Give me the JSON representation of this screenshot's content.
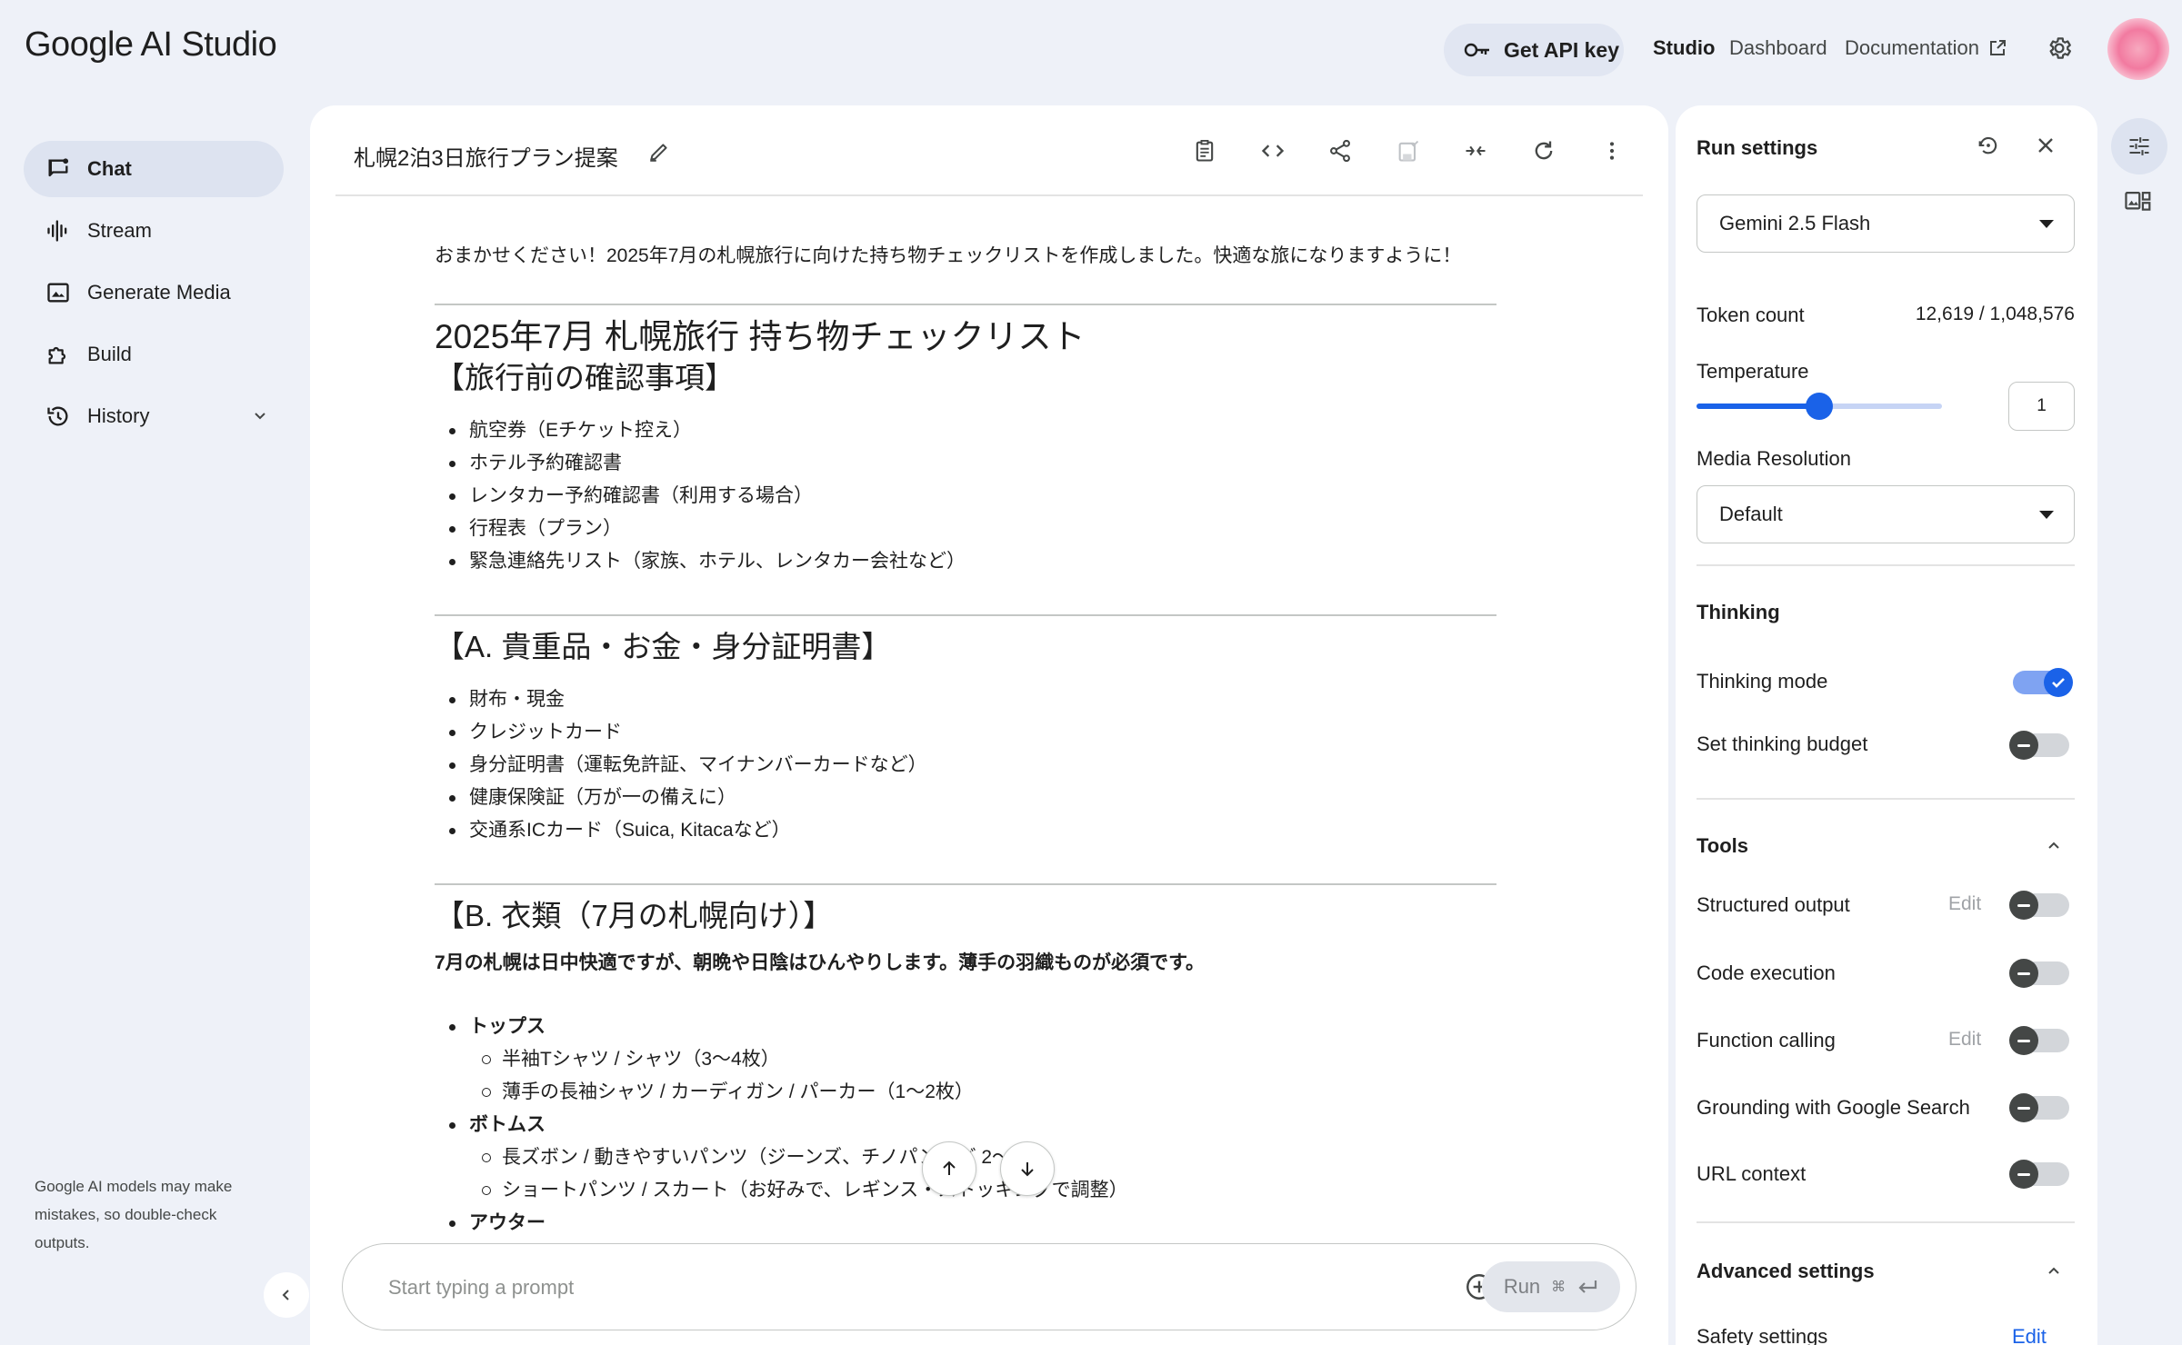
{
  "app": {
    "logo": "Google AI Studio"
  },
  "header": {
    "api_key_label": "Get API key",
    "nav": {
      "studio": "Studio",
      "dashboard": "Dashboard",
      "documentation": "Documentation"
    }
  },
  "sidebar": {
    "items": [
      {
        "label": "Chat",
        "icon": "chat-icon"
      },
      {
        "label": "Stream",
        "icon": "stream-icon"
      },
      {
        "label": "Generate Media",
        "icon": "media-icon"
      },
      {
        "label": "Build",
        "icon": "build-icon"
      },
      {
        "label": "History",
        "icon": "history-icon"
      }
    ],
    "disclaimer": "Google AI models may make mistakes, so double-check outputs."
  },
  "chat": {
    "title": "札幌2泊3日旅行プラン提案",
    "intro": "おまかせください！2025年7月の札幌旅行に向けた持ち物チェックリストを作成しました。快適な旅になりますように！",
    "heading": "2025年7月 札幌旅行 持ち物チェックリスト",
    "sections": [
      {
        "title": "【旅行前の確認事項】",
        "items": [
          "航空券（Eチケット控え）",
          "ホテル予約確認書",
          "レンタカー予約確認書（利用する場合）",
          "行程表（プラン）",
          "緊急連絡先リスト（家族、ホテル、レンタカー会社など）"
        ]
      },
      {
        "title": "【A. 貴重品・お金・身分証明書】",
        "items": [
          "財布・現金",
          "クレジットカード",
          "身分証明書（運転免許証、マイナンバーカードなど）",
          "健康保険証（万が一の備えに）",
          "交通系ICカード（Suica, Kitacaなど）"
        ]
      },
      {
        "title": "【B. 衣類（7月の札幌向け）】",
        "note": "7月の札幌は日中快適ですが、朝晩や日陰はひんやりします。薄手の羽織ものが必須です。",
        "groups": [
          {
            "label": "トップス",
            "items": [
              "半袖Tシャツ / シャツ（3〜4枚）",
              "薄手の長袖シャツ / カーディガン / パーカー（1〜2枚）"
            ]
          },
          {
            "label": "ボトムス",
            "items": [
              "長ズボン / 動きやすいパンツ（ジーンズ、チノパンなど 2〜3本）",
              "ショートパンツ / スカート（お好みで、レギンス・ストッキングで調整）"
            ]
          },
          {
            "label": "アウター",
            "items": []
          }
        ]
      }
    ]
  },
  "prompt": {
    "placeholder": "Start typing a prompt",
    "run_label": "Run",
    "run_shortcut": "⌘"
  },
  "settings": {
    "title": "Run settings",
    "model": "Gemini 2.5 Flash",
    "token_count_label": "Token count",
    "token_count_value": "12,619 / 1,048,576",
    "temperature_label": "Temperature",
    "temperature_value": "1",
    "temperature_level": 0.5,
    "media_resolution_label": "Media Resolution",
    "media_resolution_value": "Default",
    "thinking_section": "Thinking",
    "thinking_mode_label": "Thinking mode",
    "thinking_mode_on": true,
    "thinking_budget_label": "Set thinking budget",
    "thinking_budget_on": false,
    "tools_section": "Tools",
    "edit_label": "Edit",
    "tools": [
      {
        "label": "Structured output",
        "on": false,
        "editable": true
      },
      {
        "label": "Code execution",
        "on": false,
        "editable": false
      },
      {
        "label": "Function calling",
        "on": false,
        "editable": true
      },
      {
        "label": "Grounding with Google Search",
        "on": false,
        "editable": false
      },
      {
        "label": "URL context",
        "on": false,
        "editable": false
      }
    ],
    "advanced_section": "Advanced settings",
    "safety_label": "Safety settings"
  },
  "colors": {
    "accent": "#1a62e8",
    "background": "#eef1f8",
    "panel": "#ffffff"
  }
}
